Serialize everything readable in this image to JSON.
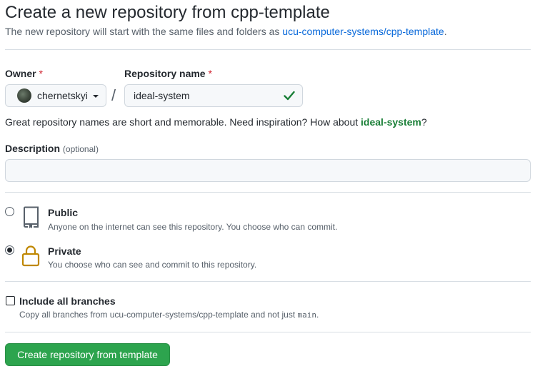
{
  "page": {
    "title": "Create a new repository from cpp-template",
    "subtitle_prefix": "The new repository will start with the same files and folders as ",
    "subtitle_link": "ucu-computer-systems/cpp-template",
    "subtitle_suffix": "."
  },
  "form": {
    "owner_label": "Owner",
    "repo_name_label": "Repository name",
    "required_mark": "*",
    "owner_value": "chernetskyi",
    "separator": "/",
    "repo_name_value": "ideal-system",
    "hint_prefix": "Great repository names are short and memorable. Need inspiration? How about ",
    "hint_suggestion": "ideal-system",
    "hint_suffix": "?",
    "description_label": "Description",
    "description_optional": "(optional)",
    "description_value": ""
  },
  "visibility": {
    "public": {
      "title": "Public",
      "desc": "Anyone on the internet can see this repository. You choose who can commit.",
      "icon": "repo-icon",
      "selected": false
    },
    "private": {
      "title": "Private",
      "desc": "You choose who can see and commit to this repository.",
      "icon": "lock-icon",
      "selected": true
    }
  },
  "branches": {
    "label": "Include all branches",
    "desc_prefix": "Copy all branches from ucu-computer-systems/cpp-template and not just ",
    "desc_code": "main",
    "desc_suffix": ".",
    "checked": false
  },
  "submit_label": "Create repository from template",
  "colors": {
    "link": "#0969da",
    "success": "#1a7f37",
    "required": "#cf222e",
    "button": "#2da44e",
    "lock": "#bf8700"
  }
}
